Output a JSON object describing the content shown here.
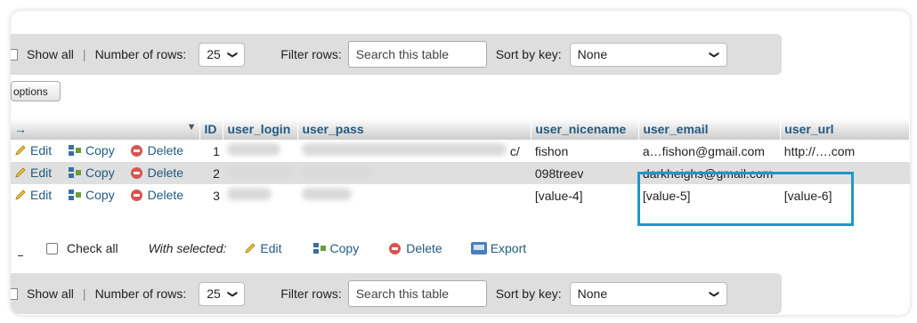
{
  "navbar": {
    "show_all": "Show all",
    "number_of_rows_label": "Number of rows:",
    "rows_value": "25",
    "filter_label": "Filter rows:",
    "filter_placeholder": "Search this table",
    "sort_label": "Sort by key:",
    "sort_value": "None"
  },
  "options_label": "options",
  "table": {
    "headers": {
      "arrow": "→",
      "id": "ID",
      "user_login": "user_login",
      "user_pass": "user_pass",
      "user_nicename": "user_nicename",
      "user_email": "user_email",
      "user_url": "user_url"
    },
    "actions": {
      "edit": "Edit",
      "copy": "Copy",
      "delete": "Delete"
    },
    "rows": [
      {
        "id": "1",
        "pass_tail": "c/",
        "nicename": "fishon",
        "email": "a…fishon@gmail.com",
        "url": "http://….com"
      },
      {
        "id": "2",
        "pass_tail": "",
        "nicename": "098treev",
        "email": "darkheighs@gmail.com",
        "url": ""
      },
      {
        "id": "3",
        "pass_tail": "",
        "nicename": "[value-4]",
        "email": "[value-5]",
        "url": "[value-6]"
      }
    ]
  },
  "bulk": {
    "check_all": "Check all",
    "with_selected": "With selected:",
    "edit": "Edit",
    "copy": "Copy",
    "delete": "Delete",
    "export": "Export"
  },
  "colors": {
    "link": "#235a81",
    "highlight": "#1e98c9",
    "toolbar_bg": "#dedede",
    "delete_red": "#d9534f"
  }
}
